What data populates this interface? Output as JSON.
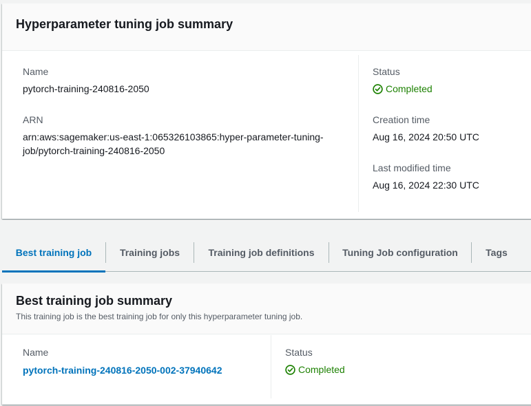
{
  "summary": {
    "title": "Hyperparameter tuning job summary",
    "name_label": "Name",
    "name_value": "pytorch-training-240816-2050",
    "arn_label": "ARN",
    "arn_line1": "arn:aws:sagemaker:us-east-1:065326103865:hyper-parameter-tuning-",
    "arn_line2": "job/pytorch-training-240816-2050",
    "status_label": "Status",
    "status_value": "Completed",
    "creation_label": "Creation time",
    "creation_value": "Aug 16, 2024 20:50 UTC",
    "modified_label": "Last modified time",
    "modified_value": "Aug 16, 2024 22:30 UTC"
  },
  "tabs": [
    {
      "label": "Best training job",
      "active": true
    },
    {
      "label": "Training jobs",
      "active": false
    },
    {
      "label": "Training job definitions",
      "active": false
    },
    {
      "label": "Tuning Job configuration",
      "active": false
    },
    {
      "label": "Tags",
      "active": false
    }
  ],
  "best": {
    "title": "Best training job summary",
    "description": "This training job is the best training job for only this hyperparameter tuning job.",
    "name_label": "Name",
    "name_value": "pytorch-training-240816-2050-002-37940642",
    "status_label": "Status",
    "status_value": "Completed"
  },
  "colors": {
    "success": "#1d8102",
    "link": "#0073bb",
    "label": "#545b64"
  },
  "icons": {
    "status": "status-success-icon"
  }
}
